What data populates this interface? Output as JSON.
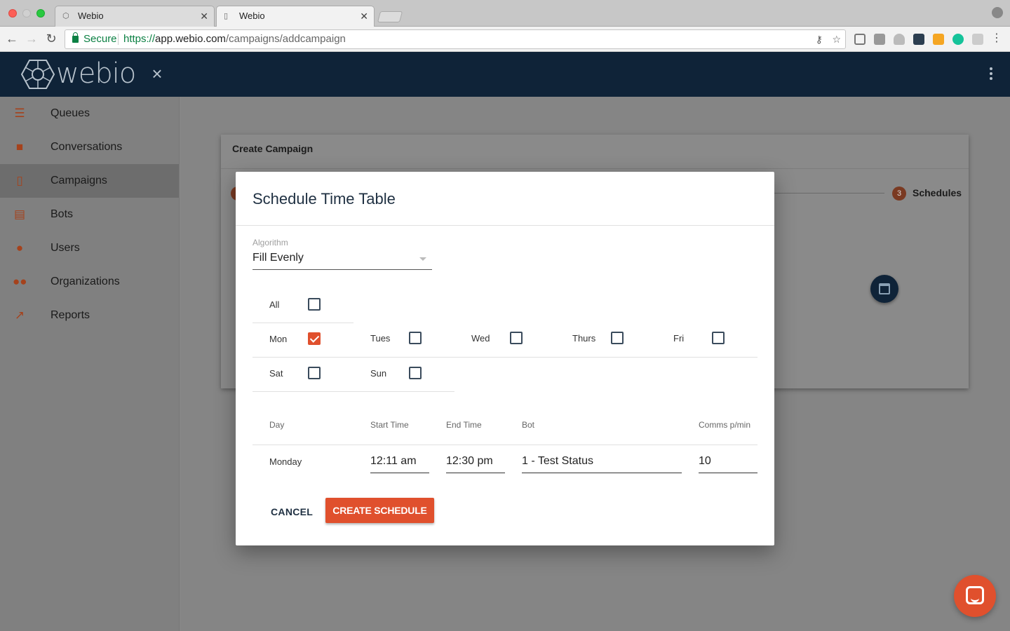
{
  "browser": {
    "tabs": [
      {
        "title": "Webio",
        "active": false
      },
      {
        "title": "Webio",
        "active": true
      }
    ],
    "secure_label": "Secure",
    "url_scheme": "https://",
    "url_host": "app.webio.com",
    "url_path": "/campaigns/addcampaign"
  },
  "app": {
    "logo_text": "webio",
    "close_icon": "×",
    "brand_color": "#0f2338",
    "accent_color": "#e0502d"
  },
  "sidebar": {
    "items": [
      {
        "label": "Queues",
        "icon": "list-icon",
        "active": false
      },
      {
        "label": "Conversations",
        "icon": "chat-bubbles-icon",
        "active": false
      },
      {
        "label": "Campaigns",
        "icon": "phone-signal-icon",
        "active": true
      },
      {
        "label": "Bots",
        "icon": "message-icon",
        "active": false
      },
      {
        "label": "Users",
        "icon": "person-icon",
        "active": false
      },
      {
        "label": "Organizations",
        "icon": "people-icon",
        "active": false
      },
      {
        "label": "Reports",
        "icon": "trending-icon",
        "active": false
      }
    ]
  },
  "campaign": {
    "title": "Create Campaign",
    "step_number": "3",
    "step_label": "Schedules"
  },
  "modal": {
    "title": "Schedule Time Table",
    "algorithm_label": "Algorithm",
    "algorithm_value": "Fill Evenly",
    "days": {
      "all": {
        "label": "All",
        "checked": false
      },
      "mon": {
        "label": "Mon",
        "checked": true
      },
      "tues": {
        "label": "Tues",
        "checked": false
      },
      "wed": {
        "label": "Wed",
        "checked": false
      },
      "thurs": {
        "label": "Thurs",
        "checked": false
      },
      "fri": {
        "label": "Fri",
        "checked": false
      },
      "sat": {
        "label": "Sat",
        "checked": false
      },
      "sun": {
        "label": "Sun",
        "checked": false
      }
    },
    "table": {
      "headers": {
        "day": "Day",
        "start": "Start Time",
        "end": "End Time",
        "bot": "Bot",
        "comms": "Comms p/min"
      },
      "rows": [
        {
          "day": "Monday",
          "start": "12:11 am",
          "end": "12:30 pm",
          "bot": "1 - Test Status",
          "comms": "10"
        }
      ]
    },
    "cancel_label": "CANCEL",
    "create_label": "CREATE SCHEDULE"
  }
}
